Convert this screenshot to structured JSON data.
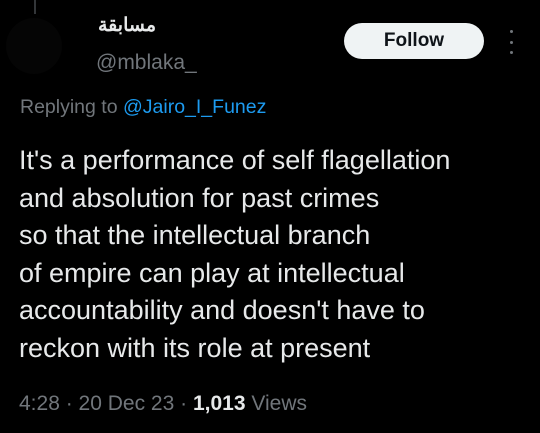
{
  "author": {
    "display_name": "مسابقة",
    "handle": "@mblaka_"
  },
  "follow_label": "Follow",
  "more_icon": "more-vertical-icon",
  "reply": {
    "prefix": "Replying to ",
    "mention": "@Jairo_I_Funez"
  },
  "tweet": {
    "lines": [
      "It's a performance of self flagellation",
      "and absolution for past crimes",
      "so that the intellectual branch",
      "of empire can play at intellectual",
      "accountability and doesn't have to",
      "reckon with its role at present"
    ]
  },
  "meta": {
    "time": "4:28",
    "sep1": " · ",
    "date": "20 Dec 23",
    "sep2": " · ",
    "views_count": "1,013",
    "views_label": " Views"
  },
  "colors": {
    "background": "#000000",
    "text": "#e7e9ea",
    "muted": "#71767b",
    "link": "#1d9bf0",
    "button_bg": "#eff3f4"
  }
}
